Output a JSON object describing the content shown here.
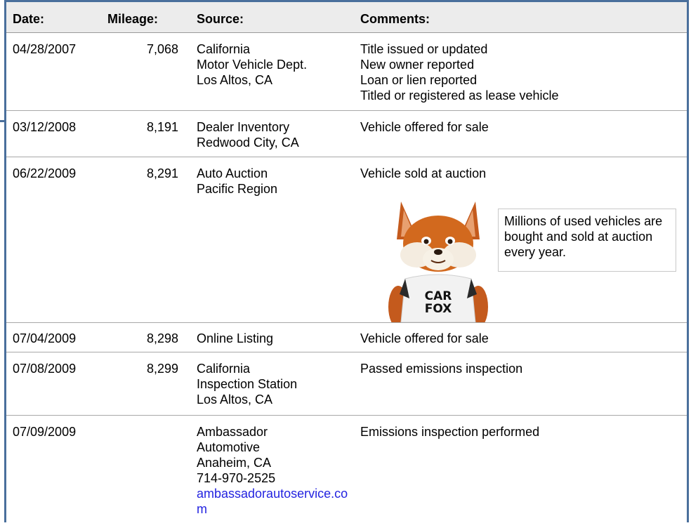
{
  "headers": {
    "date": "Date:",
    "mileage": "Mileage:",
    "source": "Source:",
    "comments": "Comments:"
  },
  "records": [
    {
      "date": "04/28/2007",
      "mileage": "7,068",
      "source": [
        "California",
        "Motor Vehicle Dept.",
        "Los Altos, CA"
      ],
      "comments": [
        "Title issued or updated",
        "New owner reported",
        "Loan or lien reported",
        "Titled or registered as lease vehicle"
      ]
    },
    {
      "date": "03/12/2008",
      "mileage": "8,191",
      "source": [
        "Dealer Inventory",
        "Redwood City, CA"
      ],
      "comments": [
        "Vehicle offered for sale"
      ]
    },
    {
      "date": "06/22/2009",
      "mileage": "8,291",
      "source": [
        "Auto Auction",
        "Pacific Region"
      ],
      "comments": [
        "Vehicle sold at auction"
      ]
    },
    {
      "date": "07/04/2009",
      "mileage": "8,298",
      "source": [
        "Online Listing"
      ],
      "comments": [
        "Vehicle offered for sale"
      ]
    },
    {
      "date": "07/08/2009",
      "mileage": "8,299",
      "source": [
        "California",
        "Inspection Station",
        "Los Altos, CA"
      ],
      "comments": [
        "Passed emissions inspection"
      ]
    },
    {
      "date": "07/09/2009",
      "mileage": "",
      "source": [
        "Ambassador",
        "Automotive",
        "Anaheim, CA",
        "714-970-2525"
      ],
      "source_link": "ambassadorautoservice.com",
      "comments": [
        "Emissions inspection performed"
      ]
    }
  ],
  "callout": {
    "text": "Millions of used vehicles are bought and sold at auction every year."
  },
  "mascot": {
    "name": "carfox-mascot-icon",
    "shirt_line1": "CAR",
    "shirt_line2": "FOX"
  },
  "colors": {
    "frame": "#4a6f9c",
    "link": "#2323e0",
    "header_bg": "#ececec"
  }
}
